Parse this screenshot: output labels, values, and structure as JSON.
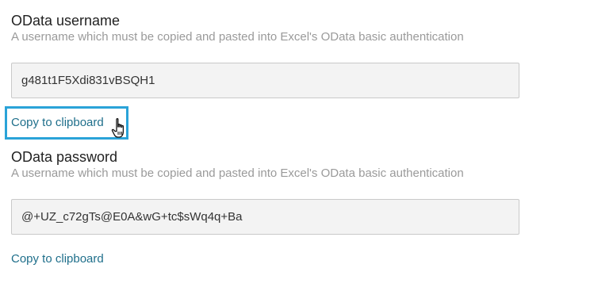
{
  "username_section": {
    "label": "OData username",
    "help": "A username which must be copied and pasted into Excel's OData basic authentication",
    "value": "g481t1F5Xdi831vBSQH1",
    "copy_label": "Copy to clipboard"
  },
  "password_section": {
    "label": "OData password",
    "help": "A username which must be copied and pasted into Excel's OData basic authentication",
    "value": "@+UZ_c72gTs@E0A&wG+tc$sWq4q+Ba",
    "copy_label": "Copy to clipboard"
  },
  "colors": {
    "link": "#1f6f8b",
    "highlight": "#2aa3d8",
    "input_bg": "#f3f3f3"
  },
  "icons": {
    "cursor": "hand-pointer-icon"
  }
}
